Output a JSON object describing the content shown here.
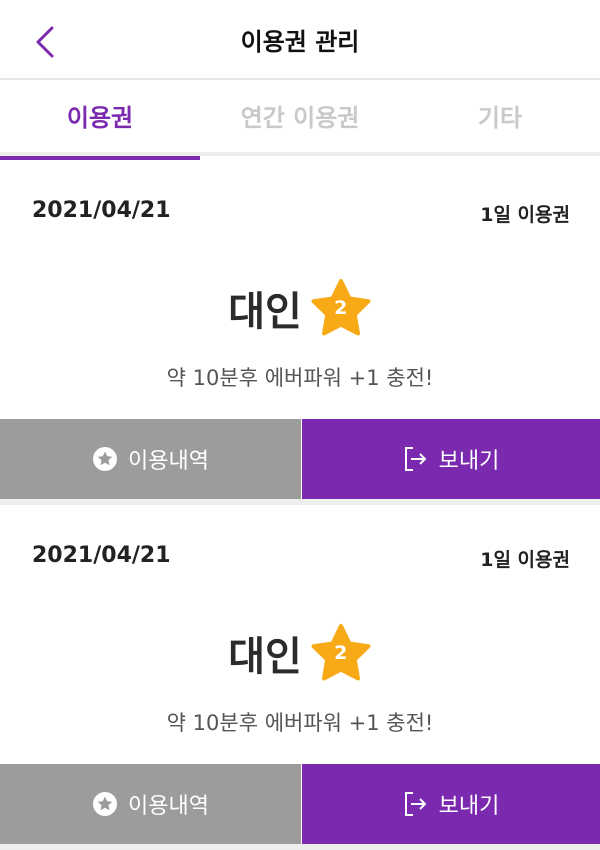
{
  "header": {
    "title": "이용권 관리",
    "back_icon": "chevron-left-icon"
  },
  "tabs": [
    {
      "label": "이용권",
      "active": true
    },
    {
      "label": "연간 이용권",
      "active": false
    },
    {
      "label": "기타",
      "active": false
    }
  ],
  "tickets": [
    {
      "date": "2021/04/21",
      "type": "1일 이용권",
      "name": "대인",
      "star_count": "2",
      "message": "약 10분후 에버파워 +1 충전!",
      "history_button": "이용내역",
      "send_button": "보내기"
    },
    {
      "date": "2021/04/21",
      "type": "1일 이용권",
      "name": "대인",
      "star_count": "2",
      "message": "약 10분후 에버파워 +1 충전!",
      "history_button": "이용내역",
      "send_button": "보내기"
    }
  ],
  "colors": {
    "accent": "#7b2ab0",
    "star": "#f8a916",
    "history_button_bg": "#9c9c9c",
    "tab_inactive": "#c9c9c9"
  }
}
